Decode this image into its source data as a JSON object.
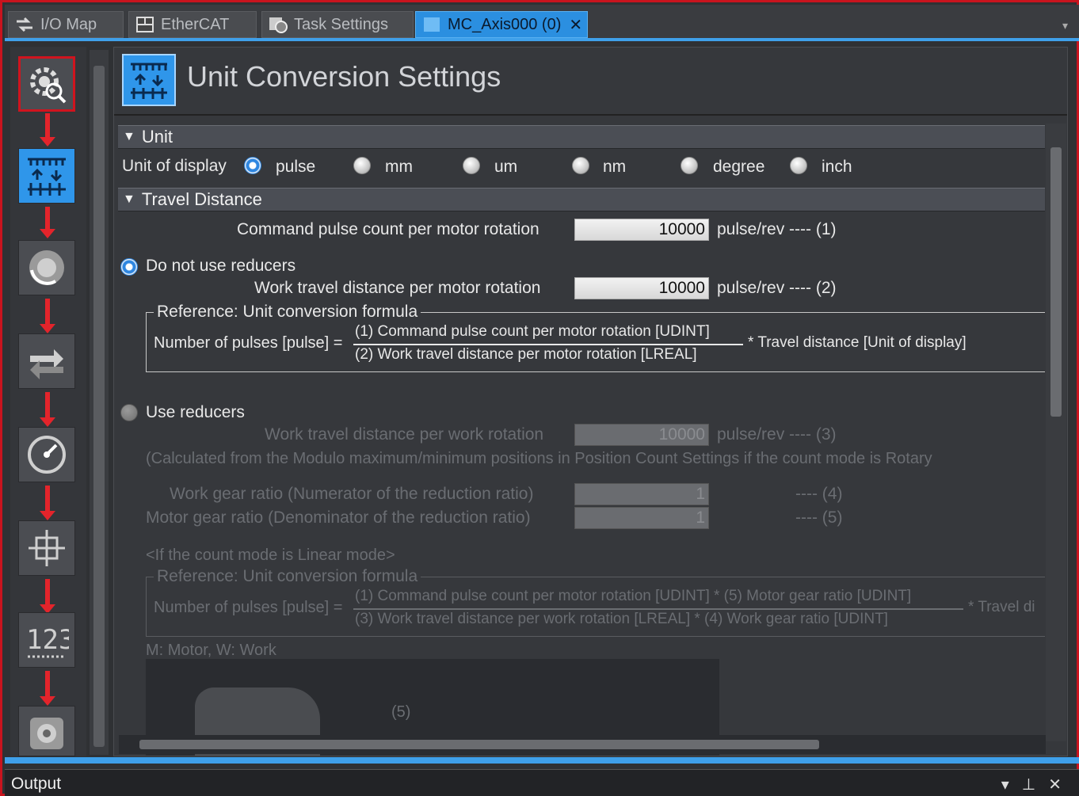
{
  "tabs": [
    {
      "label": "I/O Map",
      "icon": "io-map-icon"
    },
    {
      "label": "EtherCAT",
      "icon": "ethercat-icon"
    },
    {
      "label": "Task Settings",
      "icon": "task-settings-icon"
    },
    {
      "label": "MC_Axis000 (0)",
      "icon": "axis-icon",
      "close": "✕"
    }
  ],
  "page": {
    "title": "Unit Conversion Settings"
  },
  "unit_section": {
    "header": "Unit",
    "display_label": "Unit of display",
    "options": [
      "pulse",
      "mm",
      "um",
      "nm",
      "degree",
      "inch"
    ],
    "selected": "pulse"
  },
  "travel_section": {
    "header": "Travel Distance",
    "cmd_pulse_label": "Command pulse count per motor rotation",
    "cmd_pulse_value": "10000",
    "cmd_pulse_unit": "pulse/rev ---- (1)",
    "no_reducer_label": "Do not use reducers",
    "work_travel_label": "Work travel distance per motor rotation",
    "work_travel_value": "10000",
    "work_travel_unit": "pulse/rev ---- (2)",
    "ref1_legend": "Reference: Unit conversion formula",
    "ref1_lhs": "Number of pulses [pulse] =",
    "ref1_num": "(1) Command pulse count per motor rotation [UDINT]",
    "ref1_den": "(2) Work travel distance per motor rotation [LREAL]",
    "ref1_rhs": "* Travel distance [Unit of display]",
    "use_reducer_label": "Use reducers",
    "work_rot_label": "Work travel distance per work rotation",
    "work_rot_value": "10000",
    "work_rot_unit": "pulse/rev ---- (3)",
    "calc_note": "(Calculated from the Modulo maximum/minimum positions in Position Count Settings if the count mode is Rotary",
    "work_gear_label": "Work gear ratio (Numerator of the reduction ratio)",
    "work_gear_value": "1",
    "work_gear_unit": "---- (4)",
    "motor_gear_label": "Motor gear ratio (Denominator of the reduction ratio)",
    "motor_gear_value": "1",
    "motor_gear_unit": "---- (5)",
    "linear_note": "<If the count mode is Linear mode>",
    "ref2_legend": "Reference: Unit conversion formula",
    "ref2_lhs": "Number of pulses [pulse] =",
    "ref2_num": "(1) Command pulse count per motor rotation [UDINT] * (5) Motor gear ratio [UDINT]",
    "ref2_den": "(3) Work travel distance per work rotation [LREAL] * (4) Work gear ratio [UDINT]",
    "ref2_rhs": "* Travel di",
    "mw_note": "M: Motor, W: Work",
    "img_label": "(5)"
  },
  "output_panel": {
    "title": "Output",
    "ctrls": [
      "▾",
      "⊥",
      "✕"
    ]
  }
}
